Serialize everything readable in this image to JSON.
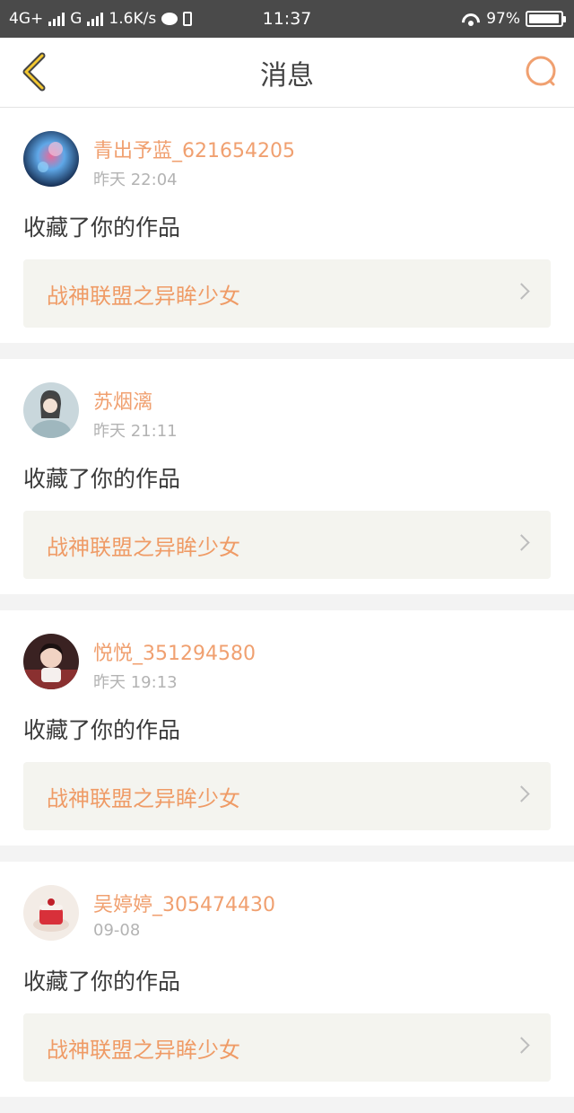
{
  "status_bar": {
    "network1": "4G+",
    "network2": "G",
    "speed": "1.6K/s",
    "time": "11:37",
    "battery_percent": "97%",
    "battery_level": 0.97
  },
  "header": {
    "title": "消息",
    "back_icon": "chevron-left-icon",
    "search_icon": "search-icon",
    "accent_color": "#f0a070"
  },
  "messages": [
    {
      "username": "青出予蓝_621654205",
      "time": "昨天 22:04",
      "action": "收藏了你的作品",
      "work_title": "战神联盟之异眸少女"
    },
    {
      "username": "苏烟漓",
      "time": "昨天 21:11",
      "action": "收藏了你的作品",
      "work_title": "战神联盟之异眸少女"
    },
    {
      "username": "悦悦_351294580",
      "time": "昨天 19:13",
      "action": "收藏了你的作品",
      "work_title": "战神联盟之异眸少女"
    },
    {
      "username": "吴婷婷_305474430",
      "time": "09-08",
      "action": "收藏了你的作品",
      "work_title": "战神联盟之异眸少女"
    }
  ]
}
